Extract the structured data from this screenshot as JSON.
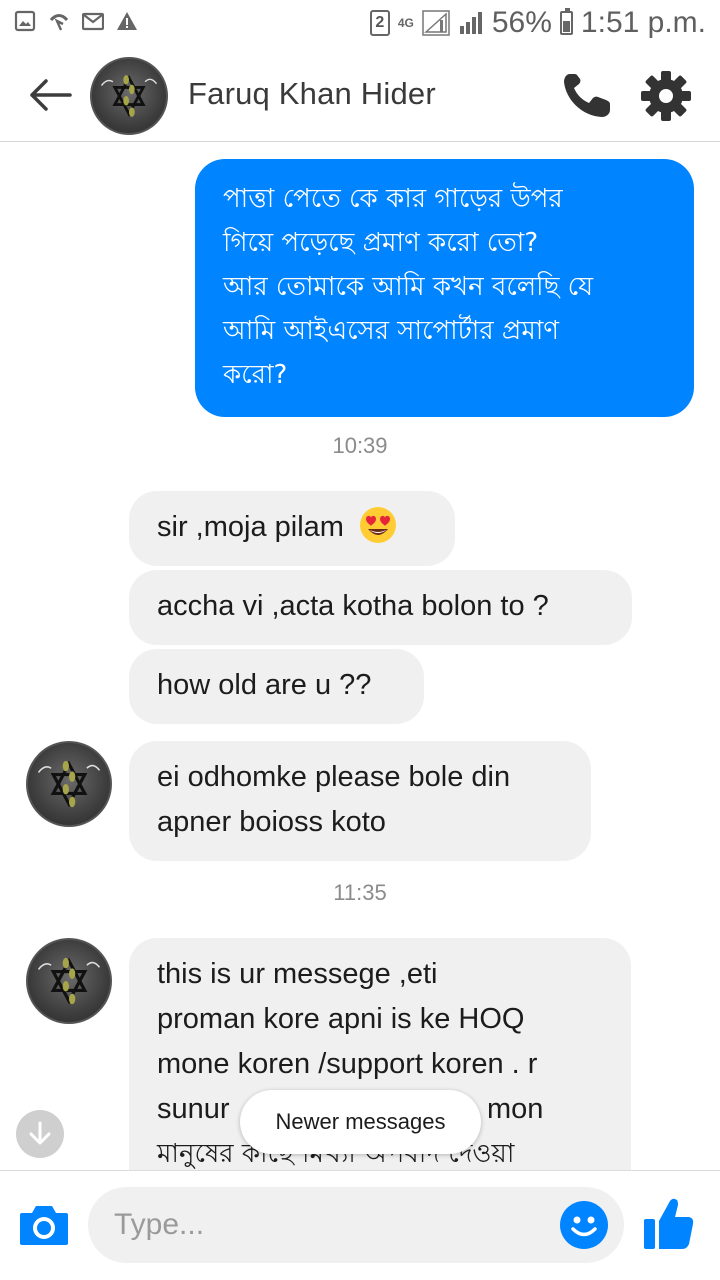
{
  "status_bar": {
    "sim_number": "2",
    "network": "4G",
    "battery": "56%",
    "time": "1:51 p.m.",
    "icons": [
      "gallery-icon",
      "missed-call-icon",
      "gmail-icon",
      "warning-icon",
      "signal-icon",
      "battery-icon"
    ]
  },
  "header": {
    "contact_name": "Faruq Khan Hider",
    "icons": [
      "back-arrow-icon",
      "phone-icon",
      "gear-icon"
    ]
  },
  "messages": {
    "outgoing": {
      "lines": [
        "পাত্তা পেতে কে কার গাড়ের উপর",
        "গিয়ে পড়েছে প্রমাণ করো তো?",
        "আর তোমাকে আমি কখন বলেছি যে",
        "আমি আইএসের সাপোর্টার প্রমাণ",
        "করো?"
      ]
    },
    "timestamp_1": "10:39",
    "incoming": [
      {
        "text": "sir ,moja pilam",
        "emoji": "heart-eyes-emoji"
      },
      {
        "text": "accha vi ,acta kotha bolon to ?"
      },
      {
        "text": "how old are u ??"
      },
      {
        "lines": [
          "ei odhomke please bole din",
          "apner boioss koto"
        ]
      }
    ],
    "timestamp_2": "11:35",
    "last_incoming": {
      "lines": [
        "this is ur messege ,eti",
        "proman kore apni is ke HOQ",
        "mone koren /support koren . r",
        "sunur",
        "mon",
        "মানুষের কাছে মিথ্যা অপবাদ দেওয়া"
      ]
    }
  },
  "newer_messages": "Newer messages",
  "composer": {
    "placeholder": "Type...",
    "icons": [
      "camera-icon",
      "emoji-icon",
      "thumbs-up-icon"
    ]
  },
  "colors": {
    "accent": "#0084ff",
    "incoming_bubble": "#f1f0f0",
    "timestamp": "#8b8b8b"
  }
}
